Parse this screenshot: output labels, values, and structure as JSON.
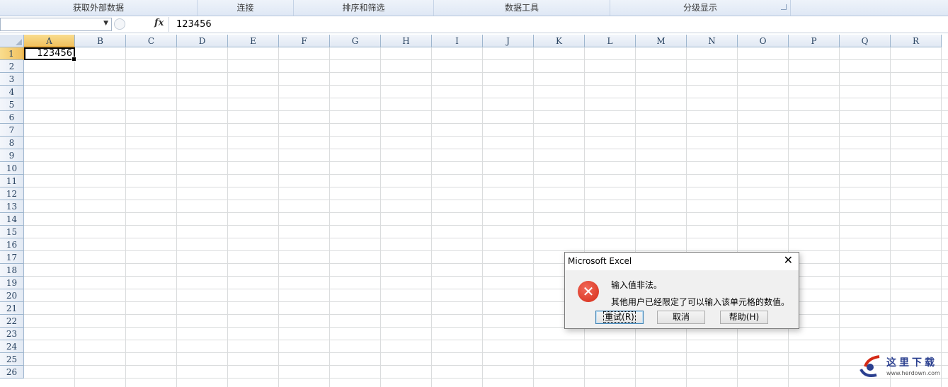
{
  "ribbon": {
    "groups": [
      "获取外部数据",
      "连接",
      "排序和筛选",
      "数据工具",
      "分级显示"
    ]
  },
  "formula_bar": {
    "name_box_value": "",
    "fx_label": "fx",
    "content": "123456"
  },
  "sheet": {
    "columns": [
      "A",
      "B",
      "C",
      "D",
      "E",
      "F",
      "G",
      "H",
      "I",
      "J",
      "K",
      "L",
      "M",
      "N",
      "O",
      "P",
      "Q",
      "R"
    ],
    "rows": [
      "1",
      "2",
      "3",
      "4",
      "5",
      "6",
      "7",
      "8",
      "9",
      "10",
      "11",
      "12",
      "13",
      "14",
      "15",
      "16",
      "17",
      "18",
      "19",
      "20",
      "21",
      "22",
      "23",
      "24",
      "25",
      "26"
    ],
    "selected_cell": "A1",
    "cell_a1_value": "123456"
  },
  "dialog": {
    "title": "Microsoft Excel",
    "close_glyph": "✕",
    "icon": "error-icon",
    "message_line1": "输入值非法。",
    "message_line2": "其他用户已经限定了可以输入该单元格的数值。",
    "buttons": {
      "retry": "重试(R)",
      "cancel": "取消",
      "help": "帮助(H)"
    }
  },
  "watermark": {
    "text": "这里下载",
    "url": "www.herdown.com"
  },
  "colors": {
    "selected_header": "#f1c15f",
    "error_red": "#d42a16",
    "header_blue": "#dfe7f2"
  }
}
